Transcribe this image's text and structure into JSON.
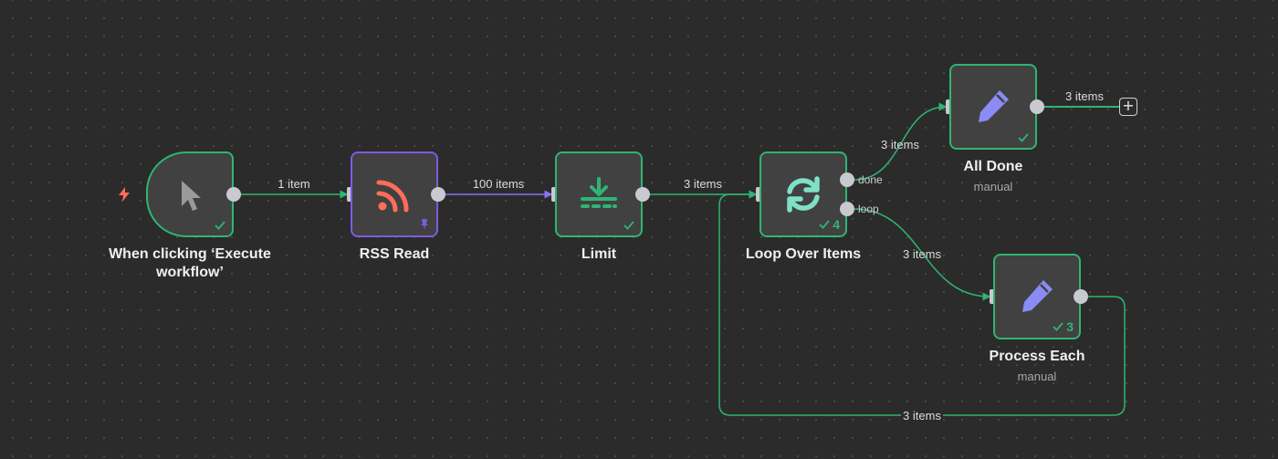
{
  "colors": {
    "canvas": "#2b2b2b",
    "node_bg": "#414141",
    "success": "#2fb573",
    "pinned": "#7e5be0",
    "rss": "#ff6d5a",
    "edit": "#8b8bf5",
    "trigger_bolt": "#ff6d5a",
    "loop_icon": "#7fe0c6"
  },
  "nodes": {
    "trigger": {
      "title": "When clicking ‘Execute workflow’",
      "icon": "cursor-icon"
    },
    "rss": {
      "title": "RSS Read",
      "icon": "rss-icon",
      "pinned": true
    },
    "limit": {
      "title": "Limit",
      "icon": "limit-icon"
    },
    "loop": {
      "title": "Loop Over Items",
      "icon": "loop-icon",
      "run_count": "4",
      "outputs": [
        "done",
        "loop"
      ]
    },
    "all_done": {
      "title": "All Done",
      "subtitle": "manual",
      "icon": "pencil-icon"
    },
    "process_each": {
      "title": "Process Each",
      "subtitle": "manual",
      "icon": "pencil-icon",
      "run_count": "3"
    }
  },
  "edges": {
    "trigger_to_rss": "1 item",
    "rss_to_limit": "100 items",
    "limit_to_loop": "3 items",
    "done_to_all_done": "3 items",
    "loop_to_process": "3 items",
    "all_done_out": "3 items",
    "process_back_to_loop": "3 items"
  },
  "add_button": "+"
}
